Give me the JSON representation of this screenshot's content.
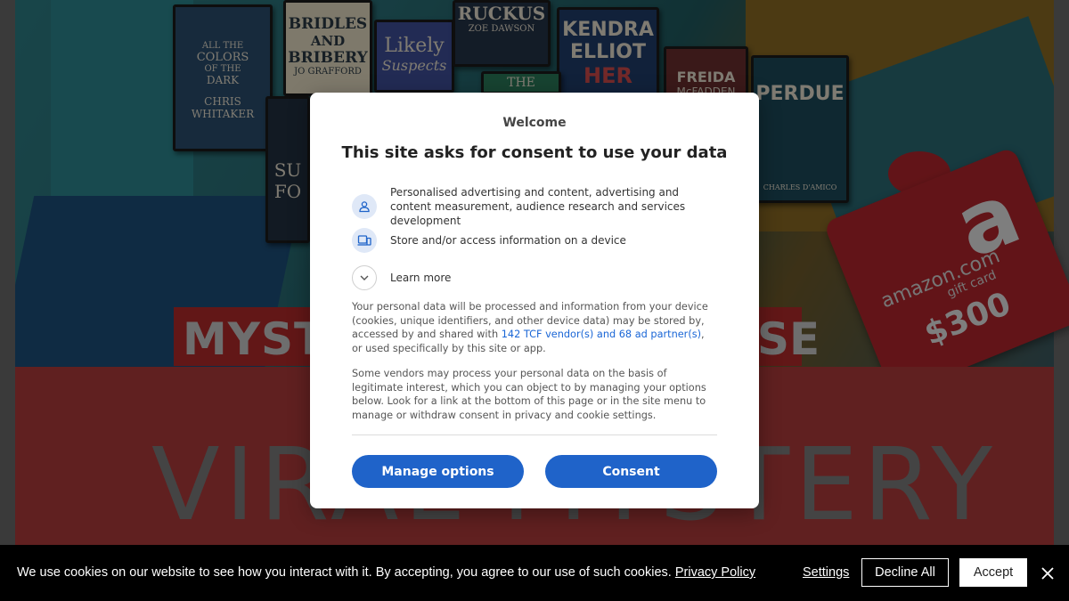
{
  "background": {
    "books": [
      {
        "lines": [
          "ALL THE",
          "COLORS",
          "OF THE",
          "DARK",
          "CHRIS",
          "WHITAKER"
        ]
      },
      {
        "lines": [
          "BRIDLES",
          "AND",
          "BRIBERY",
          "JO GRAFFORD"
        ]
      },
      {
        "lines": [
          "Likely",
          "Suspects"
        ]
      },
      {
        "lines": [
          "RUCKUS",
          "ZOE DAWSON"
        ]
      },
      {
        "lines": [
          "KENDRA",
          "ELLIOT",
          "HER"
        ]
      },
      {
        "lines": [
          "FREIDA",
          "McFADDEN"
        ]
      },
      {
        "lines": [
          "PERDUE",
          "CHARLES D'AMICO"
        ]
      },
      {
        "lines": [
          "SU",
          "FO"
        ]
      },
      {
        "lines": [
          "THE"
        ]
      }
    ],
    "banner_left": "MYST",
    "banner_right": "SE",
    "big_word": "VIRAL MYSTERY",
    "giftcard": {
      "brand": "amazon.com",
      "sub": "gift card",
      "amount": "$300",
      "logo": "a"
    }
  },
  "consent": {
    "welcome": "Welcome",
    "title": "This site asks for consent to use your data",
    "purposes": [
      {
        "icon": "person-icon",
        "text": "Personalised advertising and content, advertising and content measurement, audience research and services development"
      },
      {
        "icon": "devices-icon",
        "text": "Store and/or access information on a device"
      },
      {
        "icon": "chevron-down-icon",
        "text": "Learn more"
      }
    ],
    "para1_before": "Your personal data will be processed and information from your device (cookies, unique identifiers, and other device data) may be stored by, accessed by and shared with ",
    "para1_link": "142 TCF vendor(s) and 68 ad partner(s)",
    "para1_after": ", or used specifically by this site or app.",
    "para2": "Some vendors may process your personal data on the basis of legitimate interest, which you can object to by managing your options below. Look for a link at the bottom of this page or in the site menu to manage or withdraw consent in privacy and cookie settings.",
    "manage_label": "Manage options",
    "consent_label": "Consent",
    "colors": {
      "accent": "#1f63c9",
      "link": "#1a66d6"
    }
  },
  "cookiebar": {
    "text": "We use cookies on our website to see how you interact with it. By accepting, you agree to our use of such cookies.",
    "policy_link": "Privacy Policy",
    "settings_label": "Settings",
    "decline_label": "Decline All",
    "accept_label": "Accept"
  }
}
